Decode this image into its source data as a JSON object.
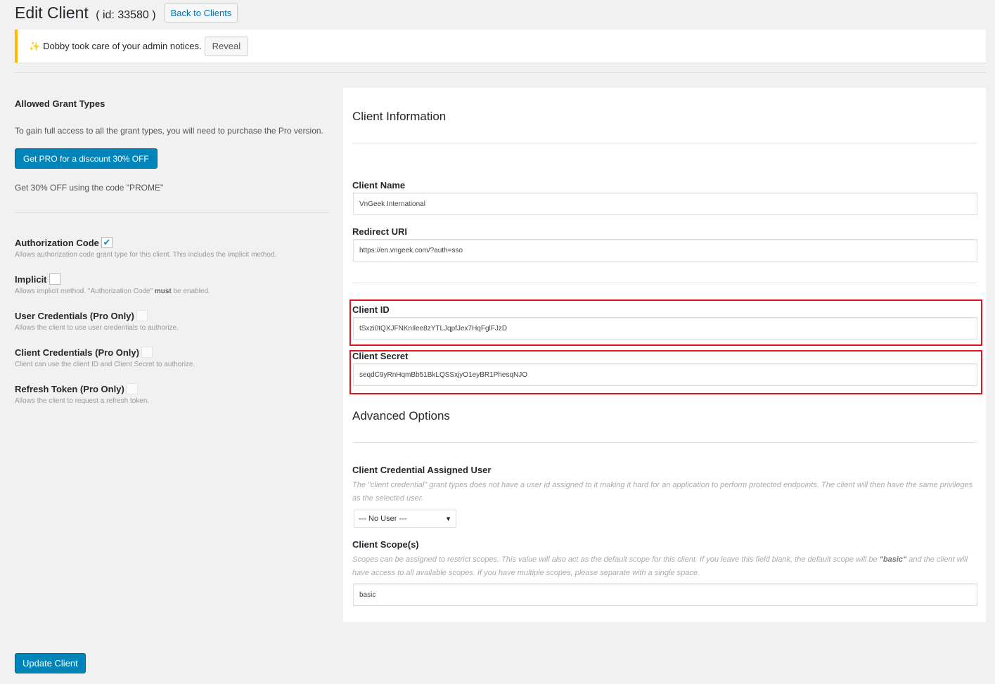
{
  "header": {
    "title": "Edit Client",
    "id_text": "( id: 33580 )",
    "back_button": "Back to Clients"
  },
  "notice": {
    "icon": "sparkle-icon",
    "text": "Dobby took care of your admin notices.",
    "reveal_button": "Reveal"
  },
  "grant_types": {
    "heading": "Allowed Grant Types",
    "description": "To gain full access to all the grant types, you will need to purchase the Pro version.",
    "pro_button": "Get PRO for a discount 30% OFF",
    "promo_text": "Get 30% OFF using the code \"PROME\"",
    "items": [
      {
        "label": "Authorization Code",
        "checked": true,
        "disabled": false,
        "description": "Allows authorization code grant type for this client. This includes the implicit method."
      },
      {
        "label": "Implicit",
        "checked": false,
        "disabled": false,
        "description_pre": "Allows implicit method. \"Authorization Code\" ",
        "description_bold": "must",
        "description_post": " be enabled."
      },
      {
        "label": "User Credentials (Pro Only)",
        "checked": false,
        "disabled": true,
        "description": "Allows the client to use user credentials to authorize."
      },
      {
        "label": "Client Credentials (Pro Only)",
        "checked": false,
        "disabled": true,
        "description": "Client can use the client ID and Client Secret to authorize."
      },
      {
        "label": "Refresh Token (Pro Only)",
        "checked": false,
        "disabled": true,
        "description": "Allows the client to request a refresh token."
      }
    ]
  },
  "client_info": {
    "heading": "Client Information",
    "name_label": "Client Name",
    "name_value": "VnGeek International",
    "redirect_label": "Redirect URI",
    "redirect_value": "https://en.vngeek.com/?auth=sso",
    "id_label": "Client ID",
    "id_value": "tSxzi0tQXJFNKnIlee8zYTLJqpfJex7HqFglFJzD",
    "secret_label": "Client Secret",
    "secret_value": "seqdC9yRnHqmBb51BkLQSSxjyO1eyBR1PhesqNJO"
  },
  "advanced": {
    "heading": "Advanced Options",
    "assigned_user_label": "Client Credential Assigned User",
    "assigned_user_help": "The \"client credential\" grant types does not have a user id assigned to it making it hard for an application to perform protected endpoints. The client will then have the same privileges as the selected user.",
    "assigned_user_value": "--- No User ---",
    "scope_label": "Client Scope(s)",
    "scope_help_pre": "Scopes can be assigned to restrict scopes. This value will also act as the default scope for this client. If you leave this field blank, the default scope will be ",
    "scope_help_bold": "\"basic\"",
    "scope_help_post": " and the client will have access to all available scopes. If you have multiple scopes, please separate with a single space.",
    "scope_value": "basic"
  },
  "footer": {
    "update_button": "Update Client"
  },
  "colors": {
    "primary": "#0085ba",
    "notice_border": "#ffb900",
    "highlight": "#e2141a"
  }
}
